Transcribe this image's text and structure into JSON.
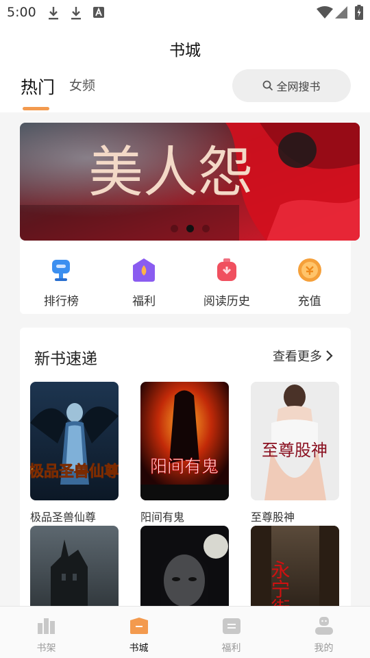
{
  "status_bar": {
    "time": "5:00"
  },
  "header": {
    "title": "书城"
  },
  "tabs": {
    "hot": "热门",
    "female": "女频"
  },
  "search": {
    "label": "全网搜书"
  },
  "banner": {
    "title_text": "美人怨",
    "slide_count": 3,
    "active_slide": 1
  },
  "quick_links": [
    {
      "label": "排行榜",
      "icon": "trophy-icon",
      "color": "#3b8ff0"
    },
    {
      "label": "福利",
      "icon": "gift-icon",
      "color": "#8a5cf0"
    },
    {
      "label": "阅读历史",
      "icon": "history-icon",
      "color": "#f0505f"
    },
    {
      "label": "充值",
      "icon": "coin-icon",
      "color": "#f5a03a"
    }
  ],
  "new_books": {
    "title": "新书速递",
    "more_label": "查看更多",
    "books": [
      {
        "name": "极品圣兽仙尊",
        "cover_text": "极品圣兽仙尊"
      },
      {
        "name": "阳间有鬼",
        "cover_text": "阳间有鬼"
      },
      {
        "name": "至尊股神",
        "cover_text": "至尊股神"
      },
      {
        "name": "",
        "cover_text": ""
      },
      {
        "name": "",
        "cover_text": ""
      },
      {
        "name": "",
        "cover_text": "永宁街"
      }
    ]
  },
  "bottom_nav": [
    {
      "label": "书架",
      "icon": "bookshelf-icon"
    },
    {
      "label": "书城",
      "icon": "bookstore-icon"
    },
    {
      "label": "福利",
      "icon": "welfare-icon"
    },
    {
      "label": "我的",
      "icon": "profile-icon"
    }
  ],
  "colors": {
    "accent": "#f39a4e",
    "banner_red": "#c8101c"
  }
}
